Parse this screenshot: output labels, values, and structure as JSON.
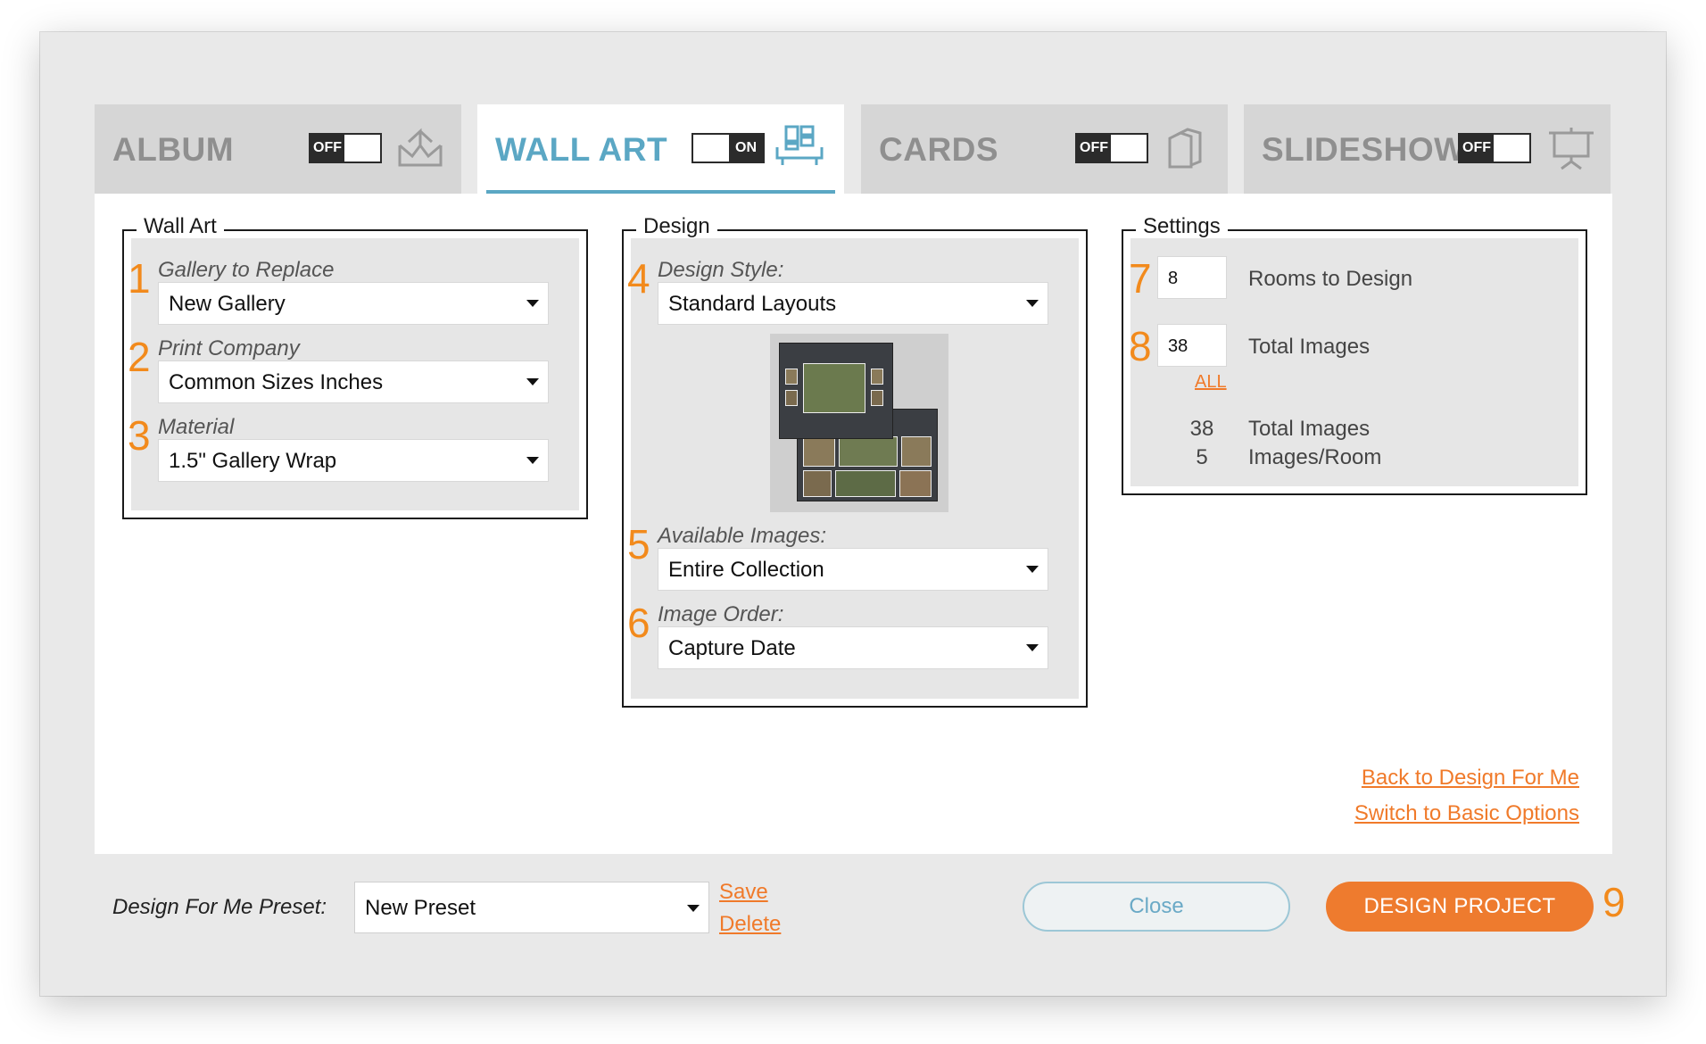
{
  "tabs": [
    {
      "label": "ALBUM",
      "toggle": "OFF",
      "icon": "album-icon"
    },
    {
      "label": "WALL ART",
      "toggle": "ON",
      "icon": "wall-art-icon"
    },
    {
      "label": "CARDS",
      "toggle": "OFF",
      "icon": "cards-icon"
    },
    {
      "label": "SLIDESHOW",
      "toggle": "OFF",
      "icon": "slideshow-icon"
    }
  ],
  "wall_art": {
    "title": "Wall Art",
    "fields": [
      {
        "num": "1",
        "label": "Gallery to Replace",
        "value": "New Gallery"
      },
      {
        "num": "2",
        "label": "Print Company",
        "value": "Common Sizes Inches"
      },
      {
        "num": "3",
        "label": "Material",
        "value": "1.5\" Gallery Wrap"
      }
    ]
  },
  "design": {
    "title": "Design",
    "style": {
      "num": "4",
      "label": "Design Style:",
      "value": "Standard Layouts"
    },
    "available": {
      "num": "5",
      "label": "Available Images:",
      "value": "Entire Collection"
    },
    "order": {
      "num": "6",
      "label": "Image Order:",
      "value": "Capture Date"
    }
  },
  "settings": {
    "title": "Settings",
    "rooms": {
      "num": "7",
      "value": "8",
      "label": "Rooms to Design"
    },
    "images": {
      "num": "8",
      "value": "38",
      "label": "Total Images"
    },
    "all_link": "ALL",
    "summary": [
      {
        "value": "38",
        "label": "Total Images"
      },
      {
        "value": "5",
        "label": "Images/Room"
      }
    ]
  },
  "links": {
    "back": "Back to Design For Me",
    "switch": "Switch to Basic Options"
  },
  "footer": {
    "preset_label": "Design For Me Preset:",
    "preset_value": "New Preset",
    "save": "Save",
    "delete": "Delete",
    "close": "Close",
    "design": "DESIGN PROJECT",
    "design_num": "9"
  },
  "colors": {
    "accent_blue": "#5ba7c4",
    "accent_orange": "#ee7b2e",
    "number_orange": "#f28a1c"
  }
}
